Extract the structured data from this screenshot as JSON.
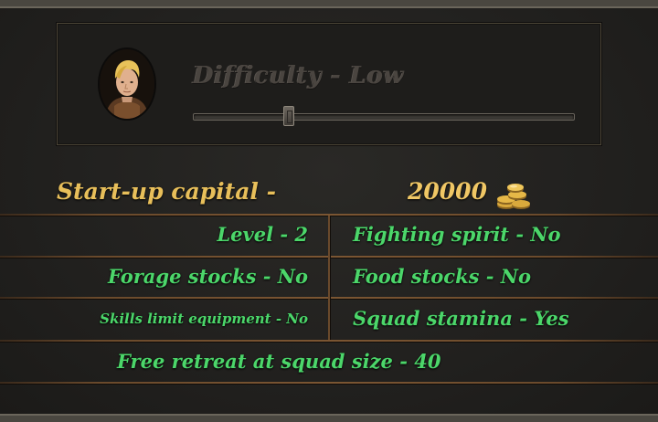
{
  "difficulty": {
    "title": "Difficulty - Low",
    "slider_value_fraction": 0.25
  },
  "capital": {
    "label": "Start-up capital -",
    "value": "20000",
    "icon": "gold-coins-icon"
  },
  "settings": {
    "level": "Level - 2",
    "fighting_spirit": "Fighting spirit - No",
    "forage_stocks": "Forage stocks - No",
    "food_stocks": "Food stocks - No",
    "skills_limit_equipment": "Skills limit equipment - No",
    "squad_stamina": "Squad stamina - Yes",
    "free_retreat": "Free retreat at squad size - 40"
  },
  "colors": {
    "setting_text": "#4cd66a",
    "capital_text": "#e8bf5a",
    "title_text": "#4a4540",
    "divider": "#7b5633"
  }
}
